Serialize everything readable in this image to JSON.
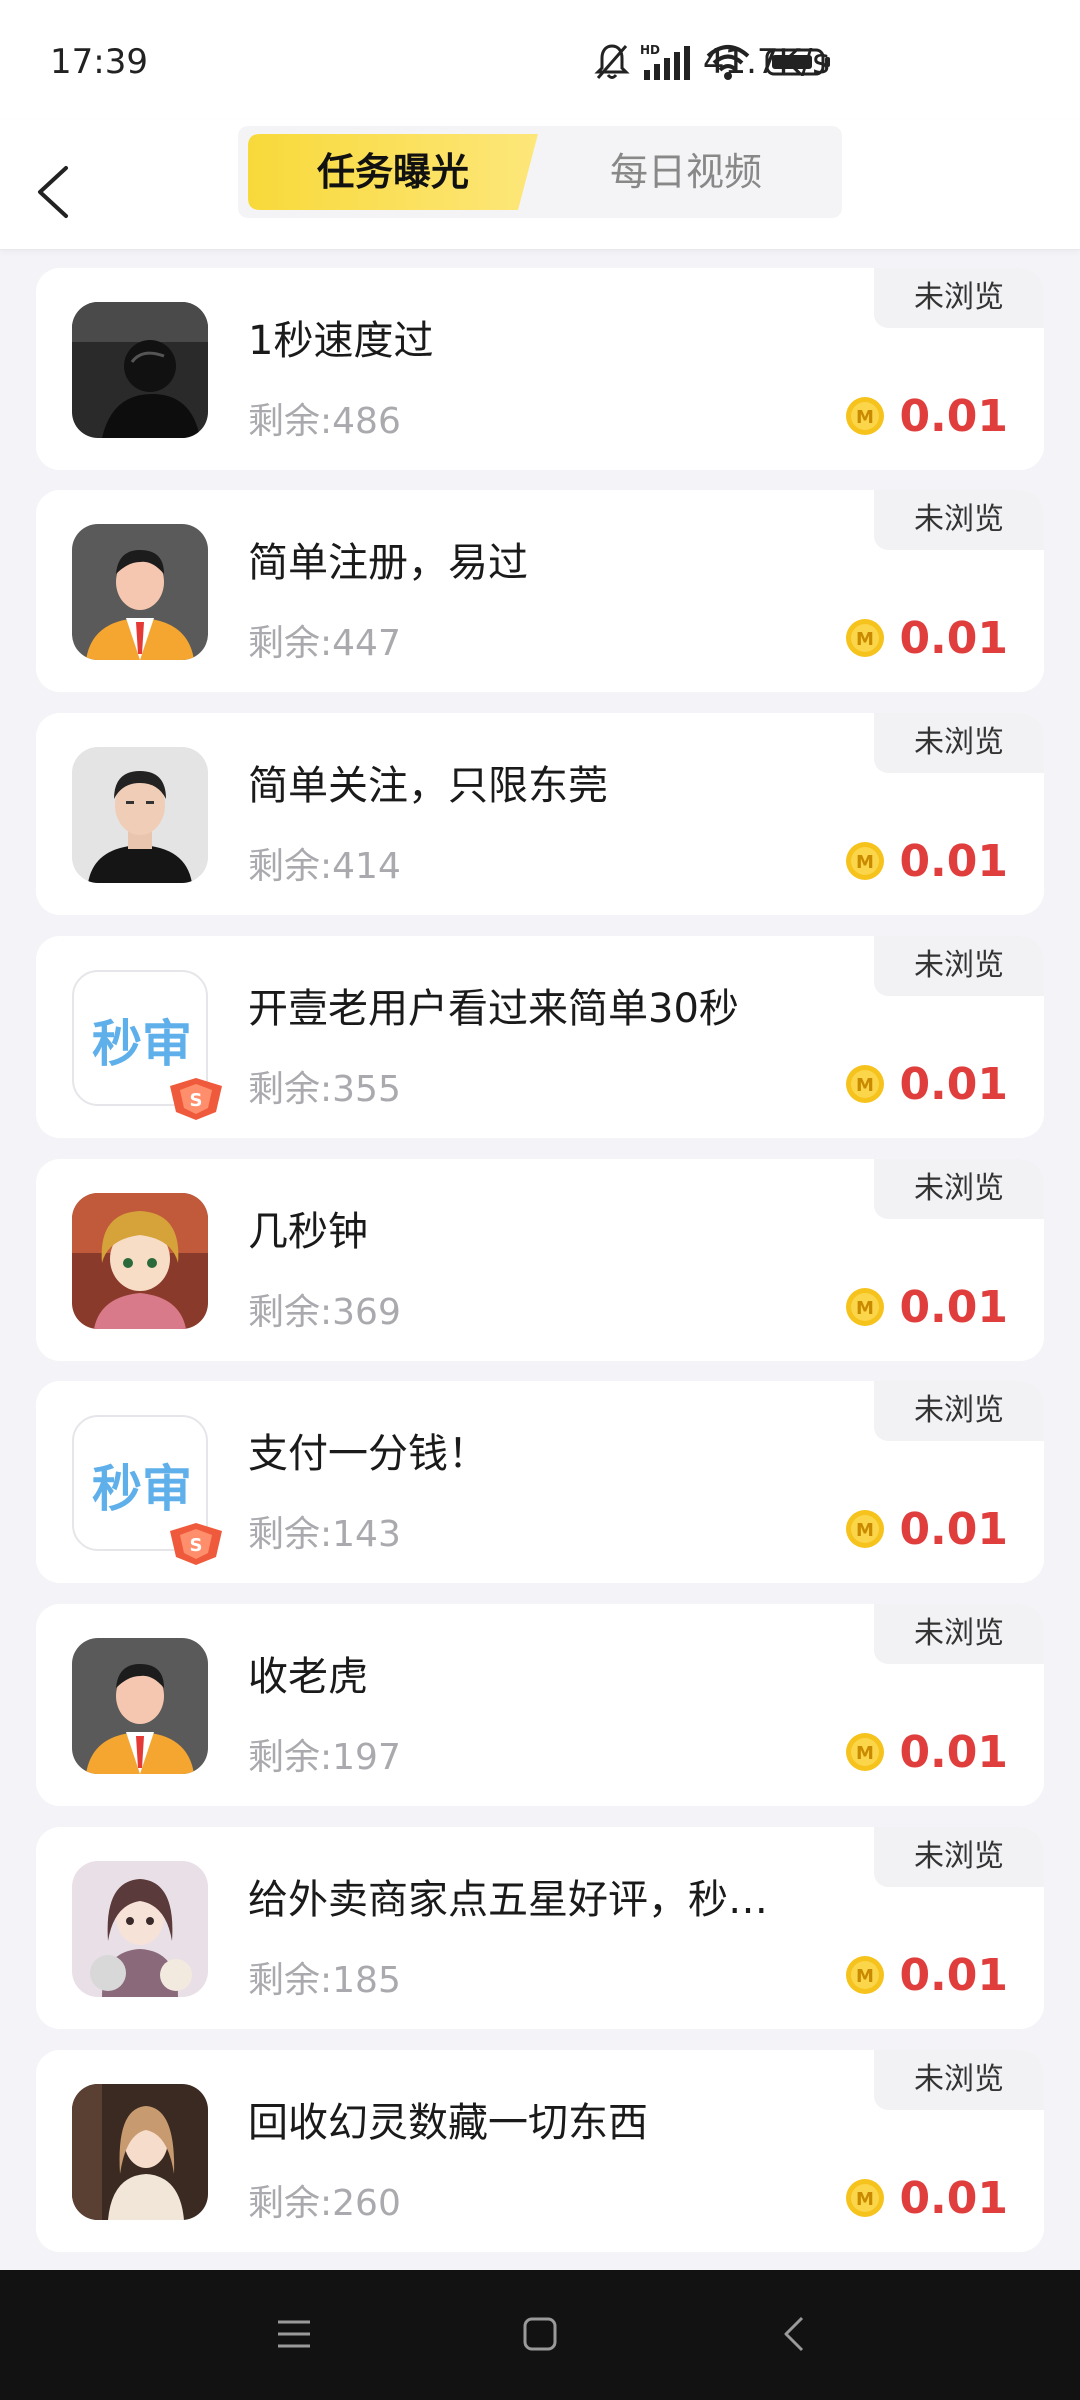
{
  "status": {
    "time": "17:39",
    "network_speed": "41.7K/s",
    "icons": [
      "bell-muted-icon",
      "hd-signal-icon",
      "wifi-icon",
      "battery-icon"
    ]
  },
  "header": {
    "back_icon": "chevron-left-icon",
    "tabs": [
      {
        "label": "任务曝光",
        "active": true
      },
      {
        "label": "每日视频",
        "active": false
      }
    ]
  },
  "colors": {
    "accent_yellow": "#f8d93a",
    "reward_red": "#e03d3d",
    "app_logo_blue": "#5fb0ea"
  },
  "tasks": [
    {
      "title": "1秒速度过",
      "remaining": "剩余:486",
      "reward": "0.01",
      "status": "未浏览",
      "avatar": "dark-portrait"
    },
    {
      "title": "简单注册，易过",
      "remaining": "剩余:447",
      "reward": "0.01",
      "status": "未浏览",
      "avatar": "default-suit"
    },
    {
      "title": "简单关注，只限东莞",
      "remaining": "剩余:414",
      "reward": "0.01",
      "status": "未浏览",
      "avatar": "man-portrait"
    },
    {
      "title": "开壹老用户看过来简单30秒",
      "remaining": "剩余:355",
      "reward": "0.01",
      "status": "未浏览",
      "avatar": "app-logo",
      "logo_text": "秒审"
    },
    {
      "title": "几秒钟",
      "remaining": "剩余:369",
      "reward": "0.01",
      "status": "未浏览",
      "avatar": "anime-boy"
    },
    {
      "title": "支付一分钱！",
      "remaining": "剩余:143",
      "reward": "0.01",
      "status": "未浏览",
      "avatar": "app-logo",
      "logo_text": "秒审"
    },
    {
      "title": "收老虎",
      "remaining": "剩余:197",
      "reward": "0.01",
      "status": "未浏览",
      "avatar": "default-suit"
    },
    {
      "title": "给外卖商家点五星好评，秒…",
      "remaining": "剩余:185",
      "reward": "0.01",
      "status": "未浏览",
      "avatar": "anime-girl-cats"
    },
    {
      "title": "回收幻灵数藏一切东西",
      "remaining": "剩余:260",
      "reward": "0.01",
      "status": "未浏览",
      "avatar": "girl-photo"
    }
  ],
  "nav": {
    "icons": [
      "menu-icon",
      "home-icon",
      "back-icon"
    ]
  }
}
